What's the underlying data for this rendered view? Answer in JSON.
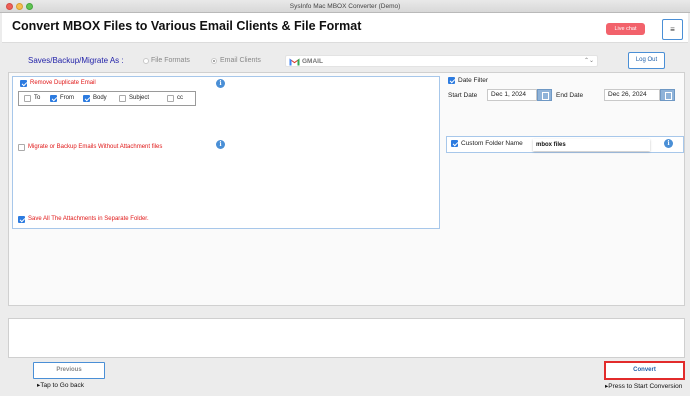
{
  "window": {
    "title": "SysInfo Mac MBOX Converter (Demo)"
  },
  "header": {
    "app_title": "Convert MBOX Files to Various Email Clients & File Format",
    "live_chat_label": "Live chat",
    "menu_icon": "hamburger-menu-icon",
    "menu_glyph": "≡"
  },
  "save_options": {
    "label": "Saves/Backup/Migrate As :",
    "options": [
      {
        "label": "File Formats",
        "selected": false
      },
      {
        "label": "Email Clients",
        "selected": true
      }
    ],
    "selected_client": "GMAIL",
    "select_arrow": "⌃⌄"
  },
  "logout_label": "Log Out",
  "filters": {
    "remove_duplicate": {
      "label": "Remove Duplicate Email",
      "checked": true
    },
    "duplicate_fields": [
      {
        "label": "To",
        "checked": false
      },
      {
        "label": "From",
        "checked": true
      },
      {
        "label": "Body",
        "checked": true
      },
      {
        "label": "Subject",
        "checked": false
      },
      {
        "label": "cc",
        "checked": false
      }
    ],
    "without_attachments": {
      "label": "Migrate or Backup Emails Without Attachment files",
      "checked": false
    },
    "separate_attachments": {
      "label": "Save All The Attachments in Separate Folder.",
      "checked": true
    },
    "info_glyph": "i"
  },
  "date_filter": {
    "label": "Date Filter",
    "checked": true,
    "start_label": "Start Date",
    "start_value": "Dec 1, 2024",
    "end_label": "End Date",
    "end_value": "Dec 26, 2024"
  },
  "custom_folder": {
    "label": "Custom Folder Name",
    "checked": true,
    "value": "mbox files"
  },
  "footer": {
    "previous_label": "Previous",
    "previous_hint": "▸Tap to Go back",
    "convert_label": "Convert",
    "convert_hint": "▸Press to Start Conversion"
  },
  "colors": {
    "accent": "#4a8fd6",
    "live_chat": "#f2626b",
    "convert_border": "#e22b2b",
    "warning_text": "#e01818"
  }
}
